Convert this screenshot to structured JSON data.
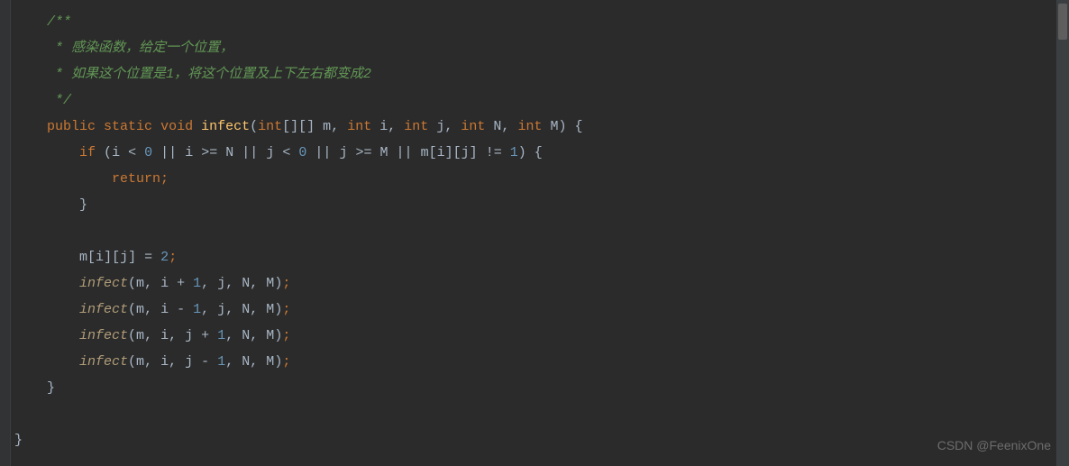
{
  "code": {
    "comment_start": "/**",
    "comment_line1": " * 感染函数，给定一个位置，",
    "comment_line2": " * 如果这个位置是1，将这个位置及上下左右都变成2",
    "comment_end": " */",
    "kw_public": "public",
    "kw_static": "static",
    "kw_void": "void",
    "method_name": "infect",
    "param_type_int_arr": "int",
    "param_brackets": "[][]",
    "param_m": "m",
    "param_type_int": "int",
    "param_i": "i",
    "param_j": "j",
    "param_N": "N",
    "param_M": "M",
    "kw_if": "if",
    "cond_i": "i",
    "cond_lt": "<",
    "num_0": "0",
    "cond_or": "||",
    "cond_gte": ">=",
    "cond_N": "N",
    "cond_j": "j",
    "cond_M": "M",
    "cond_m": "m",
    "cond_ne": "!=",
    "num_1": "1",
    "kw_return": "return",
    "assign_m": "m",
    "assign_i": "i",
    "assign_j": "j",
    "assign_eq": "=",
    "num_2": "2",
    "call_infect": "infect",
    "call_m": "m",
    "call_i": "i",
    "call_j": "j",
    "call_N": "N",
    "call_M": "M",
    "plus": "+",
    "minus": "-",
    "open_brace": "{",
    "close_brace": "}",
    "open_paren": "(",
    "close_paren": ")",
    "open_bracket": "[",
    "close_bracket": "]",
    "comma": ",",
    "semicolon": ";"
  },
  "watermark": "CSDN @FeenixOne"
}
